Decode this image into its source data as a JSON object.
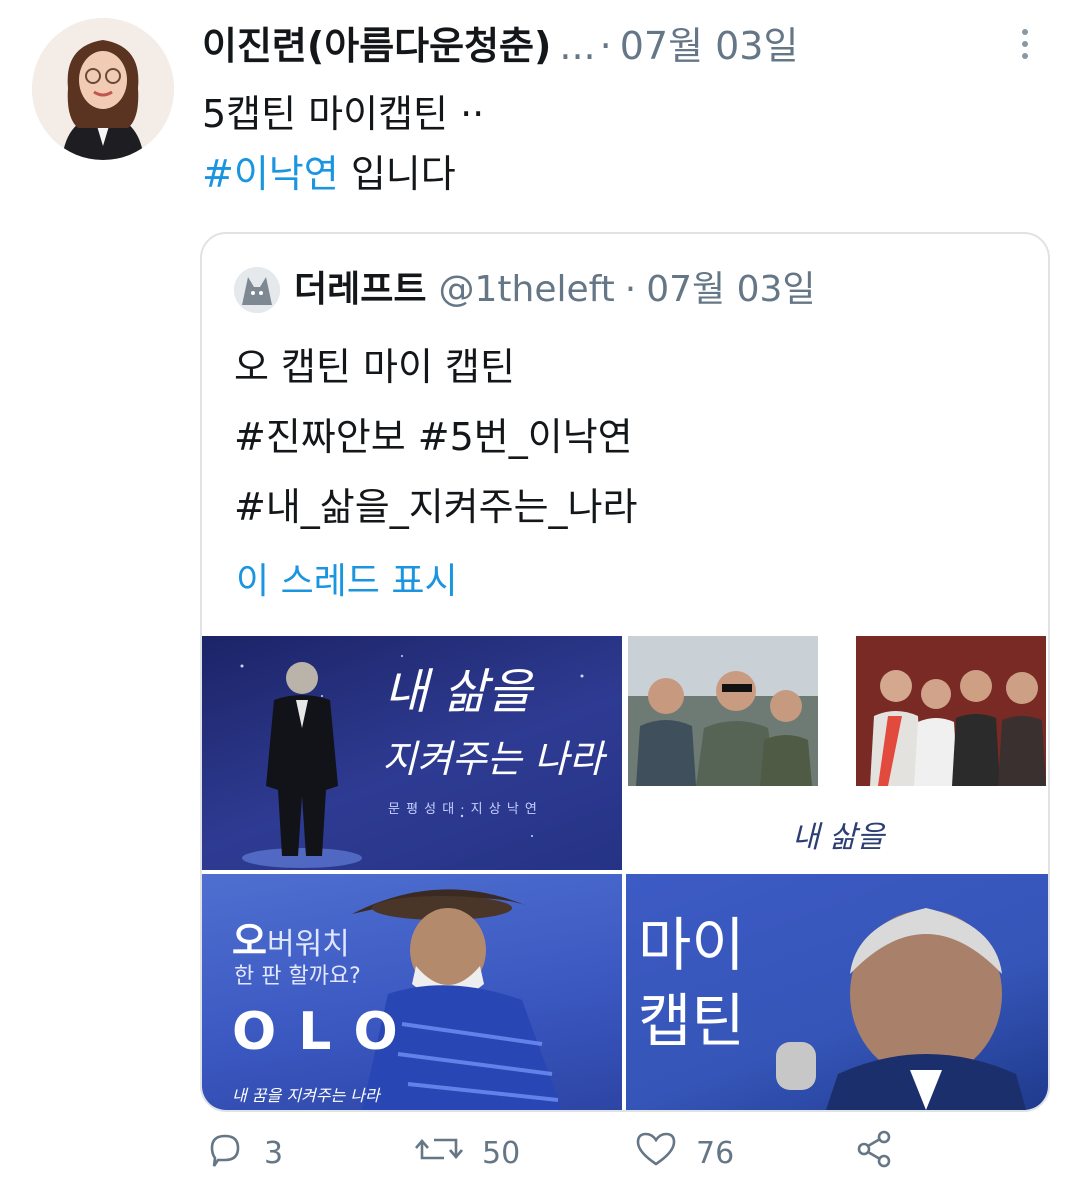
{
  "tweet": {
    "author_name": "이진련(아름다운청춘)",
    "truncation": "...",
    "separator": "·",
    "date": "07월 03일",
    "more_icon": "more-vertical-icon",
    "text_line1": "5캡틴 마이캡틴 ··",
    "hashtag": "#이낙연",
    "text_line2_rest": " 입니다"
  },
  "quote": {
    "author_name": "더레프트",
    "handle": "@1theleft",
    "separator": "·",
    "date": "07월 03일",
    "text_lines": [
      "오 캡틴 마이 캡틴",
      "#진짜안보 #5번_이낙연",
      "#내_삶을_지켜주는_나라"
    ],
    "show_thread": "이 스레드 표시",
    "media": {
      "tile1": {
        "title_line1": "내 삶을",
        "title_line2": "지켜주는 나라",
        "caption": "문 평 성 대 · 지 상 낙 연"
      },
      "tile2": {
        "caption": "내 삶을"
      },
      "tile3": {
        "headline_big": "오",
        "headline_rest": "버워치",
        "subline": "한 판 할까요?",
        "logo": "O L O",
        "footer": "내 꿈을 지켜주는 나라"
      },
      "tile4": {
        "line1": "마이",
        "line2": "캡틴"
      }
    }
  },
  "actions": {
    "reply_count": "3",
    "retweet_count": "50",
    "like_count": "76",
    "icons": [
      "reply-icon",
      "retweet-icon",
      "like-icon",
      "share-icon"
    ]
  },
  "colors": {
    "link": "#1b95e0",
    "muted": "#657786",
    "border": "#dfe3e6"
  }
}
